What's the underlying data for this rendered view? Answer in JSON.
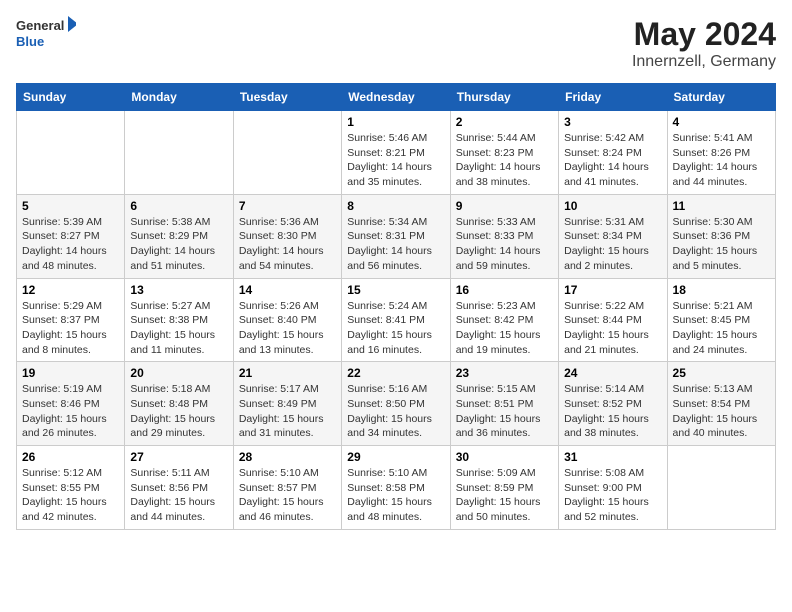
{
  "logo": {
    "general": "General",
    "blue": "Blue"
  },
  "title": "May 2024",
  "location": "Innernzell, Germany",
  "days_of_week": [
    "Sunday",
    "Monday",
    "Tuesday",
    "Wednesday",
    "Thursday",
    "Friday",
    "Saturday"
  ],
  "weeks": [
    [
      {
        "day": "",
        "info": ""
      },
      {
        "day": "",
        "info": ""
      },
      {
        "day": "",
        "info": ""
      },
      {
        "day": "1",
        "info": "Sunrise: 5:46 AM\nSunset: 8:21 PM\nDaylight: 14 hours\nand 35 minutes."
      },
      {
        "day": "2",
        "info": "Sunrise: 5:44 AM\nSunset: 8:23 PM\nDaylight: 14 hours\nand 38 minutes."
      },
      {
        "day": "3",
        "info": "Sunrise: 5:42 AM\nSunset: 8:24 PM\nDaylight: 14 hours\nand 41 minutes."
      },
      {
        "day": "4",
        "info": "Sunrise: 5:41 AM\nSunset: 8:26 PM\nDaylight: 14 hours\nand 44 minutes."
      }
    ],
    [
      {
        "day": "5",
        "info": "Sunrise: 5:39 AM\nSunset: 8:27 PM\nDaylight: 14 hours\nand 48 minutes."
      },
      {
        "day": "6",
        "info": "Sunrise: 5:38 AM\nSunset: 8:29 PM\nDaylight: 14 hours\nand 51 minutes."
      },
      {
        "day": "7",
        "info": "Sunrise: 5:36 AM\nSunset: 8:30 PM\nDaylight: 14 hours\nand 54 minutes."
      },
      {
        "day": "8",
        "info": "Sunrise: 5:34 AM\nSunset: 8:31 PM\nDaylight: 14 hours\nand 56 minutes."
      },
      {
        "day": "9",
        "info": "Sunrise: 5:33 AM\nSunset: 8:33 PM\nDaylight: 14 hours\nand 59 minutes."
      },
      {
        "day": "10",
        "info": "Sunrise: 5:31 AM\nSunset: 8:34 PM\nDaylight: 15 hours\nand 2 minutes."
      },
      {
        "day": "11",
        "info": "Sunrise: 5:30 AM\nSunset: 8:36 PM\nDaylight: 15 hours\nand 5 minutes."
      }
    ],
    [
      {
        "day": "12",
        "info": "Sunrise: 5:29 AM\nSunset: 8:37 PM\nDaylight: 15 hours\nand 8 minutes."
      },
      {
        "day": "13",
        "info": "Sunrise: 5:27 AM\nSunset: 8:38 PM\nDaylight: 15 hours\nand 11 minutes."
      },
      {
        "day": "14",
        "info": "Sunrise: 5:26 AM\nSunset: 8:40 PM\nDaylight: 15 hours\nand 13 minutes."
      },
      {
        "day": "15",
        "info": "Sunrise: 5:24 AM\nSunset: 8:41 PM\nDaylight: 15 hours\nand 16 minutes."
      },
      {
        "day": "16",
        "info": "Sunrise: 5:23 AM\nSunset: 8:42 PM\nDaylight: 15 hours\nand 19 minutes."
      },
      {
        "day": "17",
        "info": "Sunrise: 5:22 AM\nSunset: 8:44 PM\nDaylight: 15 hours\nand 21 minutes."
      },
      {
        "day": "18",
        "info": "Sunrise: 5:21 AM\nSunset: 8:45 PM\nDaylight: 15 hours\nand 24 minutes."
      }
    ],
    [
      {
        "day": "19",
        "info": "Sunrise: 5:19 AM\nSunset: 8:46 PM\nDaylight: 15 hours\nand 26 minutes."
      },
      {
        "day": "20",
        "info": "Sunrise: 5:18 AM\nSunset: 8:48 PM\nDaylight: 15 hours\nand 29 minutes."
      },
      {
        "day": "21",
        "info": "Sunrise: 5:17 AM\nSunset: 8:49 PM\nDaylight: 15 hours\nand 31 minutes."
      },
      {
        "day": "22",
        "info": "Sunrise: 5:16 AM\nSunset: 8:50 PM\nDaylight: 15 hours\nand 34 minutes."
      },
      {
        "day": "23",
        "info": "Sunrise: 5:15 AM\nSunset: 8:51 PM\nDaylight: 15 hours\nand 36 minutes."
      },
      {
        "day": "24",
        "info": "Sunrise: 5:14 AM\nSunset: 8:52 PM\nDaylight: 15 hours\nand 38 minutes."
      },
      {
        "day": "25",
        "info": "Sunrise: 5:13 AM\nSunset: 8:54 PM\nDaylight: 15 hours\nand 40 minutes."
      }
    ],
    [
      {
        "day": "26",
        "info": "Sunrise: 5:12 AM\nSunset: 8:55 PM\nDaylight: 15 hours\nand 42 minutes."
      },
      {
        "day": "27",
        "info": "Sunrise: 5:11 AM\nSunset: 8:56 PM\nDaylight: 15 hours\nand 44 minutes."
      },
      {
        "day": "28",
        "info": "Sunrise: 5:10 AM\nSunset: 8:57 PM\nDaylight: 15 hours\nand 46 minutes."
      },
      {
        "day": "29",
        "info": "Sunrise: 5:10 AM\nSunset: 8:58 PM\nDaylight: 15 hours\nand 48 minutes."
      },
      {
        "day": "30",
        "info": "Sunrise: 5:09 AM\nSunset: 8:59 PM\nDaylight: 15 hours\nand 50 minutes."
      },
      {
        "day": "31",
        "info": "Sunrise: 5:08 AM\nSunset: 9:00 PM\nDaylight: 15 hours\nand 52 minutes."
      },
      {
        "day": "",
        "info": ""
      }
    ]
  ]
}
